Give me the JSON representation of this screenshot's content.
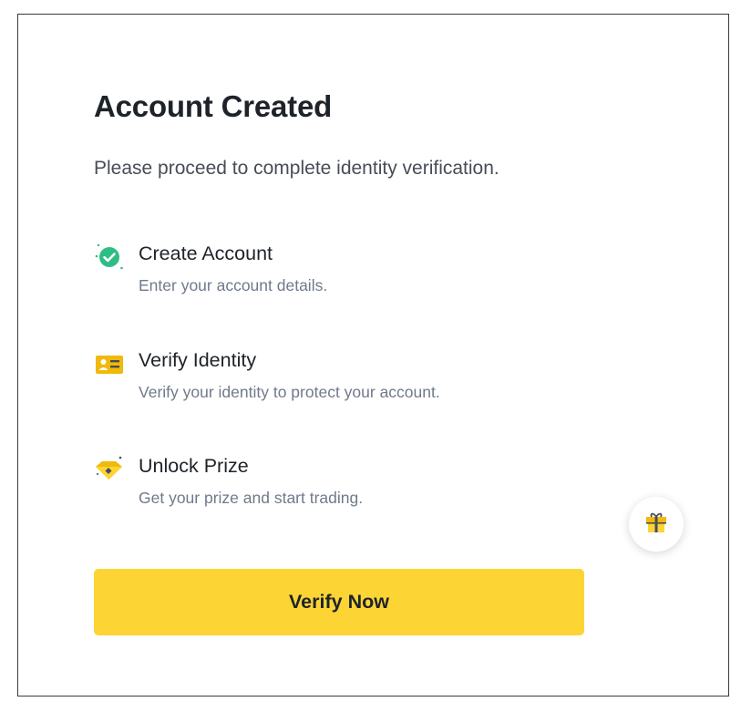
{
  "dialog": {
    "title": "Account Created",
    "subtitle": "Please proceed to complete identity verification."
  },
  "steps": [
    {
      "title": "Create Account",
      "description": "Enter your account details.",
      "icon": "check-circle-icon",
      "status": "completed"
    },
    {
      "title": "Verify Identity",
      "description": "Verify your identity to protect your account.",
      "icon": "id-card-icon",
      "status": "current"
    },
    {
      "title": "Unlock Prize",
      "description": "Get your prize and start trading.",
      "icon": "diamond-prize-icon",
      "status": "locked"
    }
  ],
  "actions": {
    "verify_label": "Verify Now"
  },
  "floating": {
    "icon": "gift-icon"
  },
  "colors": {
    "accent": "#FCD535",
    "success": "#2EBD85",
    "text_primary": "#1E2329",
    "text_secondary": "#707A8A"
  }
}
